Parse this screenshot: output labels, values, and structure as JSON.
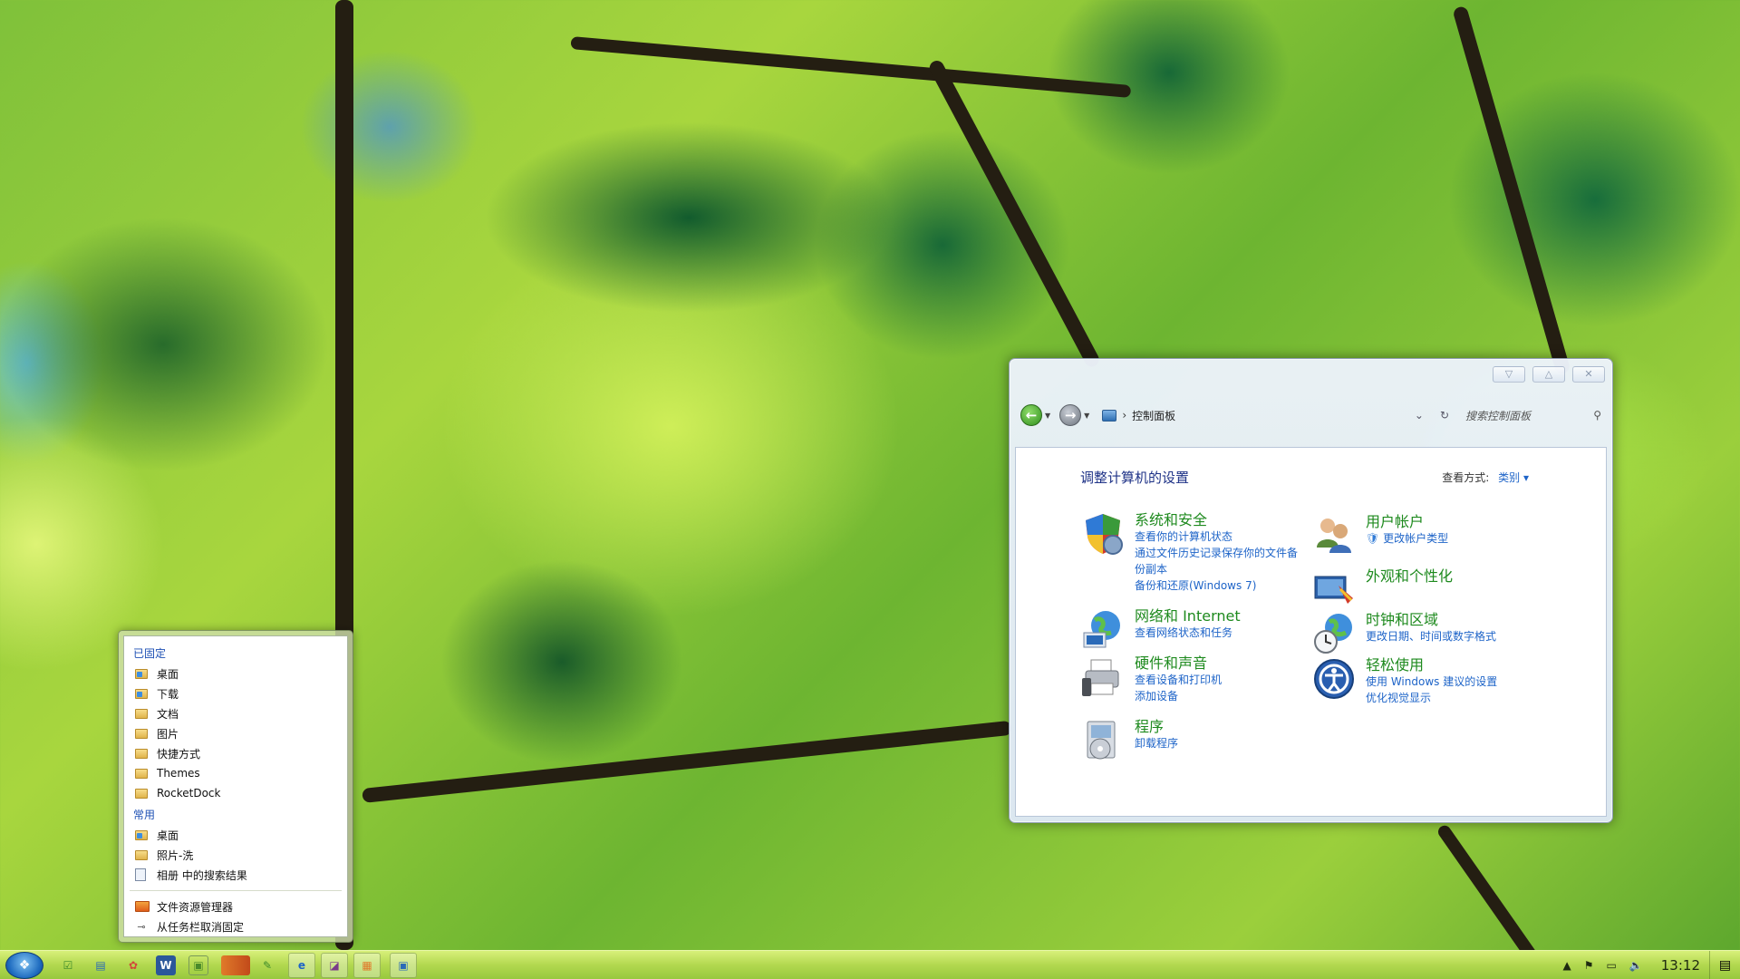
{
  "control_panel": {
    "breadcrumb": "控制面板",
    "search_placeholder": "搜索控制面板",
    "heading": "调整计算机的设置",
    "view_label": "查看方式:",
    "view_value": "类别",
    "categories": [
      {
        "title": "系统和安全",
        "icon": "security-shield-icon",
        "links": [
          "查看你的计算机状态",
          "通过文件历史记录保存你的文件备份副本",
          "备份和还原(Windows 7)"
        ]
      },
      {
        "title": "网络和 Internet",
        "icon": "network-globe-icon",
        "links": [
          "查看网络状态和任务"
        ]
      },
      {
        "title": "硬件和声音",
        "icon": "printer-icon",
        "links": [
          "查看设备和打印机",
          "添加设备"
        ]
      },
      {
        "title": "程序",
        "icon": "programs-icon",
        "links": [
          "卸载程序"
        ]
      },
      {
        "title": "用户帐户",
        "icon": "users-icon",
        "links": [
          "更改帐户类型"
        ]
      },
      {
        "title": "外观和个性化",
        "icon": "appearance-icon",
        "links": []
      },
      {
        "title": "时钟和区域",
        "icon": "clock-globe-icon",
        "links": [
          "更改日期、时间或数字格式"
        ]
      },
      {
        "title": "轻松使用",
        "icon": "ease-of-access-icon",
        "links": [
          "使用 Windows 建议的设置",
          "优化视觉显示"
        ]
      }
    ]
  },
  "jumplist": {
    "pinned_label": "已固定",
    "pinned": [
      "桌面",
      "下载",
      "文档",
      "图片",
      "快捷方式",
      "Themes",
      "RocketDock"
    ],
    "frequent_label": "常用",
    "frequent": [
      "桌面",
      "照片-洗",
      "相册 中的搜索结果"
    ],
    "tasks": [
      "文件资源管理器",
      "从任务栏取消固定"
    ]
  },
  "taskbar": {
    "clock": "13:12"
  },
  "colors": {
    "link": "#1e64c8",
    "category_title": "#1e8a1e",
    "heading": "#1e3287"
  }
}
